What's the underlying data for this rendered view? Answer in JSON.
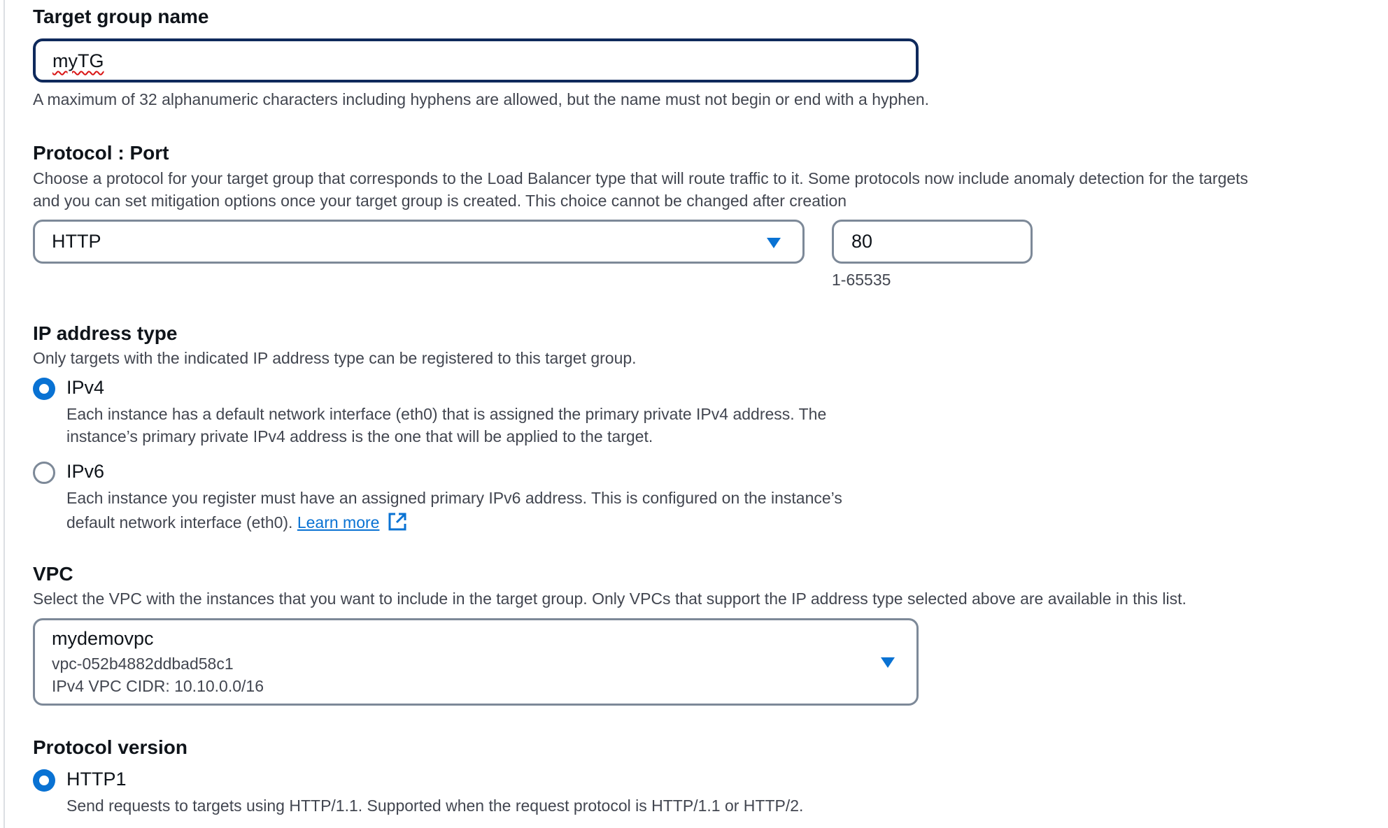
{
  "target_group_name": {
    "label": "Target group name",
    "value": "myTG",
    "hint": "A maximum of 32 alphanumeric characters including hyphens are allowed, but the name must not begin or end with a hyphen."
  },
  "protocol_port": {
    "label": "Protocol : Port",
    "description_line1": "Choose a protocol for your target group that corresponds to the Load Balancer type that will route traffic to it. Some protocols now include anomaly detection for the targets",
    "description_line2": "and you can set mitigation options once your target group is created. This choice cannot be changed after creation",
    "protocol_selected": "HTTP",
    "port_value": "80",
    "port_hint": "1-65535"
  },
  "ip_address_type": {
    "label": "IP address type",
    "description": "Only targets with the indicated IP address type can be registered to this target group.",
    "options": [
      {
        "label": "IPv4",
        "checked": true,
        "desc_line1": "Each instance has a default network interface (eth0) that is assigned the primary private IPv4 address. The",
        "desc_line2": "instance’s primary private IPv4 address is the one that will be applied to the target."
      },
      {
        "label": "IPv6",
        "checked": false,
        "desc_line1": "Each instance you register must have an assigned primary IPv6 address. This is configured on the instance’s",
        "desc_line2": "default network interface (eth0).",
        "link_text": "Learn more"
      }
    ]
  },
  "vpc": {
    "label": "VPC",
    "description": "Select the VPC with the instances that you want to include in the target group. Only VPCs that support the IP address type selected above are available in this list.",
    "selected_name": "mydemovpc",
    "selected_id": "vpc-052b4882ddbad58c1",
    "selected_cidr": "IPv4 VPC CIDR: 10.10.0.0/16"
  },
  "protocol_version": {
    "label": "Protocol version",
    "options": [
      {
        "label": "HTTP1",
        "checked": true,
        "desc": "Send requests to targets using HTTP/1.1. Supported when the request protocol is HTTP/1.1 or HTTP/2."
      }
    ]
  },
  "colors": {
    "accent": "#0972d3",
    "focus_border": "#0f2a5c",
    "border": "#7d8998",
    "text": "#0f141a",
    "secondary_text": "#424650"
  }
}
